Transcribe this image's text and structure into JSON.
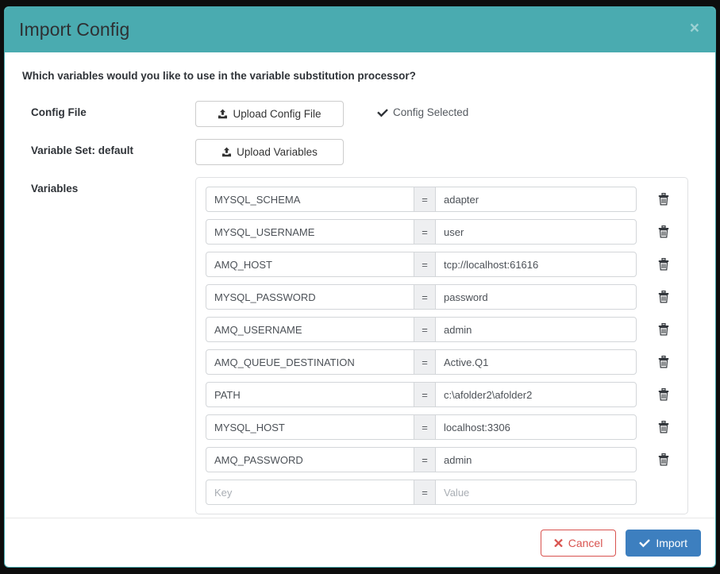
{
  "modal": {
    "title": "Import Config",
    "close_label": "×",
    "close_icon": "close-icon",
    "prompt": "Which variables would you like to use in the variable substitution processor?",
    "accent_color": "#4aabb0"
  },
  "config_file": {
    "label": "Config File",
    "upload_button": "Upload Config File",
    "upload_icon": "upload-icon",
    "status_text": "Config Selected",
    "status_icon": "check-icon"
  },
  "variable_set": {
    "label": "Variable Set: default",
    "upload_button": "Upload Variables",
    "upload_icon": "upload-icon"
  },
  "variables": {
    "label": "Variables",
    "separator": "=",
    "delete_icon": "trash-icon",
    "key_placeholder": "Key",
    "value_placeholder": "Value",
    "rows": [
      {
        "key": "MYSQL_SCHEMA",
        "value": "adapter"
      },
      {
        "key": "MYSQL_USERNAME",
        "value": "user"
      },
      {
        "key": "AMQ_HOST",
        "value": "tcp://localhost:61616"
      },
      {
        "key": "MYSQL_PASSWORD",
        "value": "password"
      },
      {
        "key": "AMQ_USERNAME",
        "value": "admin"
      },
      {
        "key": "AMQ_QUEUE_DESTINATION",
        "value": "Active.Q1"
      },
      {
        "key": "PATH",
        "value": "c:\\afolder2\\afolder2"
      },
      {
        "key": "MYSQL_HOST",
        "value": "localhost:3306"
      },
      {
        "key": "AMQ_PASSWORD",
        "value": "admin"
      },
      {
        "key": "",
        "value": ""
      }
    ]
  },
  "footer": {
    "cancel_label": "Cancel",
    "cancel_icon": "times-icon",
    "cancel_color": "#d9534f",
    "import_label": "Import",
    "import_icon": "check-icon",
    "import_color": "#3d7fbf"
  }
}
